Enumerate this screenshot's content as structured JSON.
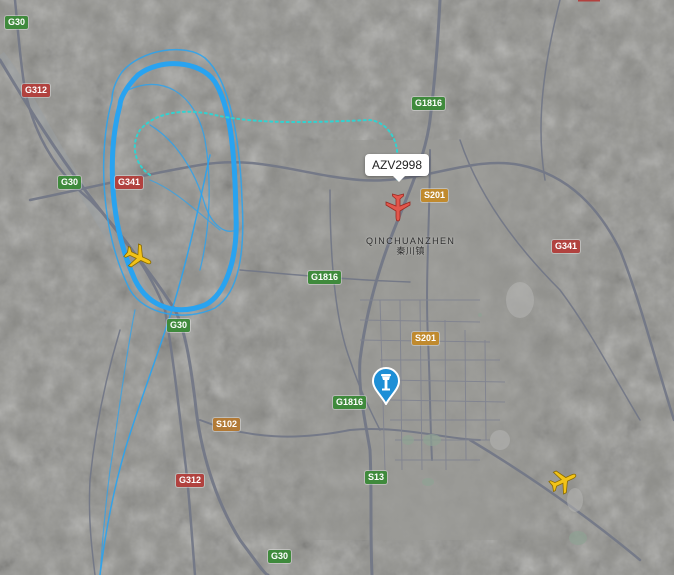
{
  "selected_flight": {
    "callsign": "AZV2998",
    "color": "#e2574c"
  },
  "other_aircraft": [
    {
      "name": "aircraft-yellow-1",
      "color": "#f2c318"
    },
    {
      "name": "aircraft-yellow-2",
      "color": "#f2c318"
    }
  ],
  "town": {
    "name_en": "QINCHUANZHEN",
    "name_zh": "秦川镇"
  },
  "road_shields": [
    {
      "label": "G30",
      "kind": "expressway"
    },
    {
      "label": "G312",
      "kind": "national"
    },
    {
      "label": "G30",
      "kind": "expressway"
    },
    {
      "label": "G341",
      "kind": "national"
    },
    {
      "label": "G1816",
      "kind": "expressway"
    },
    {
      "label": "S201",
      "kind": "provincial"
    },
    {
      "label": "G341",
      "kind": "national"
    },
    {
      "label": "G1816",
      "kind": "expressway"
    },
    {
      "label": "G30",
      "kind": "expressway"
    },
    {
      "label": "S201",
      "kind": "provincial"
    },
    {
      "label": "G1816",
      "kind": "expressway"
    },
    {
      "label": "S102",
      "kind": "county"
    },
    {
      "label": "G312",
      "kind": "national"
    },
    {
      "label": "S13",
      "kind": "expressway"
    },
    {
      "label": "G30",
      "kind": "expressway"
    }
  ],
  "airport": {
    "icon": "control-tower-icon",
    "color": "#1d8fd6"
  },
  "colors": {
    "track_primary": "#29a3f0",
    "track_recent": "#32d2d0",
    "road": "#7b7f8a",
    "terrain": "#8f8f8b"
  }
}
